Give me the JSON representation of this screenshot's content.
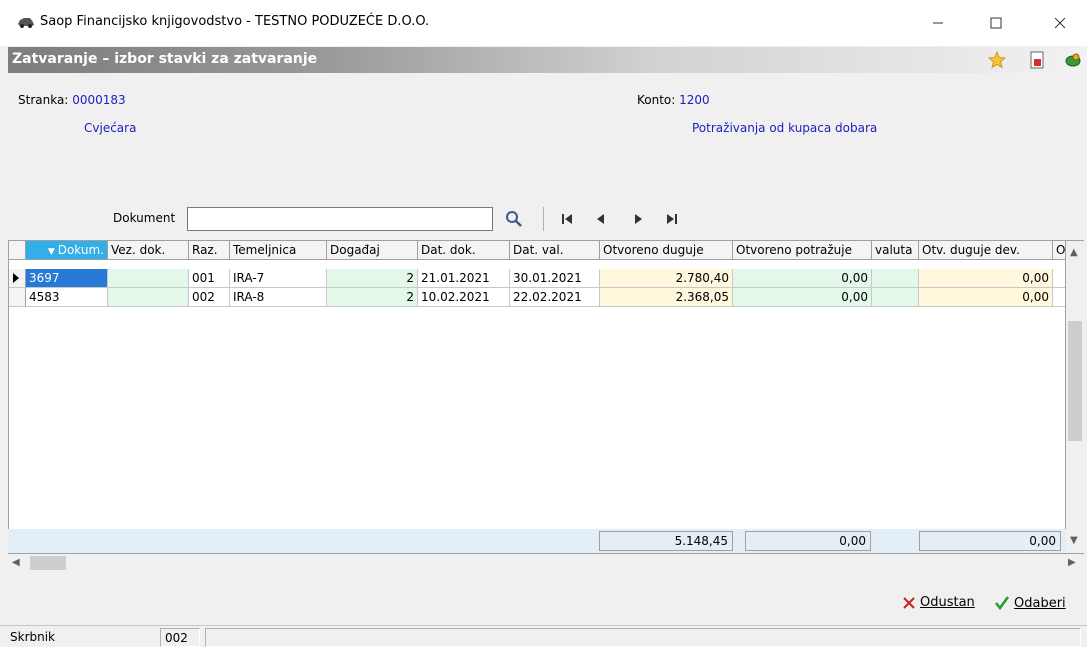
{
  "window": {
    "title": "Saop Financijsko knjigovodstvo - TESTNO PODUZEĆE D.O.O."
  },
  "caption": {
    "title": "Zatvaranje – izbor stavki za zatvaranje"
  },
  "partner": {
    "label": "Stranka:",
    "code": "0000183",
    "name": "Cvjećara"
  },
  "account": {
    "label": "Konto:",
    "code": "1200",
    "name": "Potraživanja od kupaca dobara"
  },
  "search": {
    "label": "Dokument",
    "value": ""
  },
  "table": {
    "headers": [
      "Dokum.",
      "Vez. dok.",
      "Raz.",
      "Temeljnica",
      "Događaj",
      "Dat. dok.",
      "Dat. val.",
      "Otvoreno duguje",
      "Otvoreno potražuje",
      "valuta",
      "Otv. duguje dev.",
      "O"
    ],
    "rows": [
      [
        "3697",
        "",
        "001",
        "IRA-7",
        "2",
        "21.01.2021",
        "30.01.2021",
        "2.780,40",
        "0,00",
        "",
        "0,00"
      ],
      [
        "4583",
        "",
        "002",
        "IRA-8",
        "2",
        "10.02.2021",
        "22.02.2021",
        "2.368,05",
        "0,00",
        "",
        "0,00"
      ]
    ],
    "totals": {
      "duguje": "5.148,45",
      "potrazuje": "0,00",
      "duguje_dev": "0,00"
    }
  },
  "actions": {
    "cancel": "Odustan",
    "select": "Odaberi"
  },
  "statusbar": {
    "label": "Skrbnik",
    "value": "002"
  },
  "colors": {
    "accent": "#2878d7",
    "link_text": "#2020c0",
    "row_green": "#e4f8ea",
    "row_yellow": "#fff8dc"
  },
  "icons": [
    "car-icon",
    "star-icon",
    "document-icon",
    "money-icon",
    "search-icon",
    "first-icon",
    "prev-icon",
    "next-icon",
    "last-icon",
    "cancel-icon",
    "check-icon"
  ]
}
